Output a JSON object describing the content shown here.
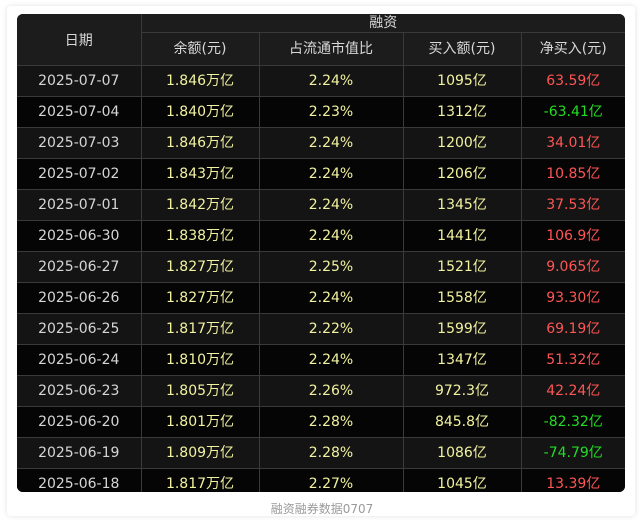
{
  "colors": {
    "table_bg": "#000000",
    "header_bg": "#1c1c1c",
    "value_yellow": "#f2f2a0",
    "positive_red": "#ff5555",
    "negative_green": "#22dd22"
  },
  "table": {
    "date_header": "日期",
    "group_header": "融资",
    "columns": [
      "余额(元)",
      "占流通市值比",
      "买入额(元)",
      "净买入(元)"
    ],
    "rows": [
      {
        "date": "2025-07-07",
        "balance": "1.846万亿",
        "ratio": "2.24%",
        "buy": "1095亿",
        "net": "63.59亿",
        "net_sign": "pos"
      },
      {
        "date": "2025-07-04",
        "balance": "1.840万亿",
        "ratio": "2.23%",
        "buy": "1312亿",
        "net": "-63.41亿",
        "net_sign": "neg"
      },
      {
        "date": "2025-07-03",
        "balance": "1.846万亿",
        "ratio": "2.24%",
        "buy": "1200亿",
        "net": "34.01亿",
        "net_sign": "pos"
      },
      {
        "date": "2025-07-02",
        "balance": "1.843万亿",
        "ratio": "2.24%",
        "buy": "1206亿",
        "net": "10.85亿",
        "net_sign": "pos"
      },
      {
        "date": "2025-07-01",
        "balance": "1.842万亿",
        "ratio": "2.24%",
        "buy": "1345亿",
        "net": "37.53亿",
        "net_sign": "pos"
      },
      {
        "date": "2025-06-30",
        "balance": "1.838万亿",
        "ratio": "2.24%",
        "buy": "1441亿",
        "net": "106.9亿",
        "net_sign": "pos"
      },
      {
        "date": "2025-06-27",
        "balance": "1.827万亿",
        "ratio": "2.25%",
        "buy": "1521亿",
        "net": "9.065亿",
        "net_sign": "pos"
      },
      {
        "date": "2025-06-26",
        "balance": "1.827万亿",
        "ratio": "2.24%",
        "buy": "1558亿",
        "net": "93.30亿",
        "net_sign": "pos"
      },
      {
        "date": "2025-06-25",
        "balance": "1.817万亿",
        "ratio": "2.22%",
        "buy": "1599亿",
        "net": "69.19亿",
        "net_sign": "pos"
      },
      {
        "date": "2025-06-24",
        "balance": "1.810万亿",
        "ratio": "2.24%",
        "buy": "1347亿",
        "net": "51.32亿",
        "net_sign": "pos"
      },
      {
        "date": "2025-06-23",
        "balance": "1.805万亿",
        "ratio": "2.26%",
        "buy": "972.3亿",
        "net": "42.24亿",
        "net_sign": "pos"
      },
      {
        "date": "2025-06-20",
        "balance": "1.801万亿",
        "ratio": "2.28%",
        "buy": "845.8亿",
        "net": "-82.32亿",
        "net_sign": "neg"
      },
      {
        "date": "2025-06-19",
        "balance": "1.809万亿",
        "ratio": "2.28%",
        "buy": "1086亿",
        "net": "-74.79亿",
        "net_sign": "neg"
      },
      {
        "date": "2025-06-18",
        "balance": "1.817万亿",
        "ratio": "2.27%",
        "buy": "1045亿",
        "net": "13.39亿",
        "net_sign": "pos"
      }
    ]
  },
  "caption": "融资融券数据0707"
}
